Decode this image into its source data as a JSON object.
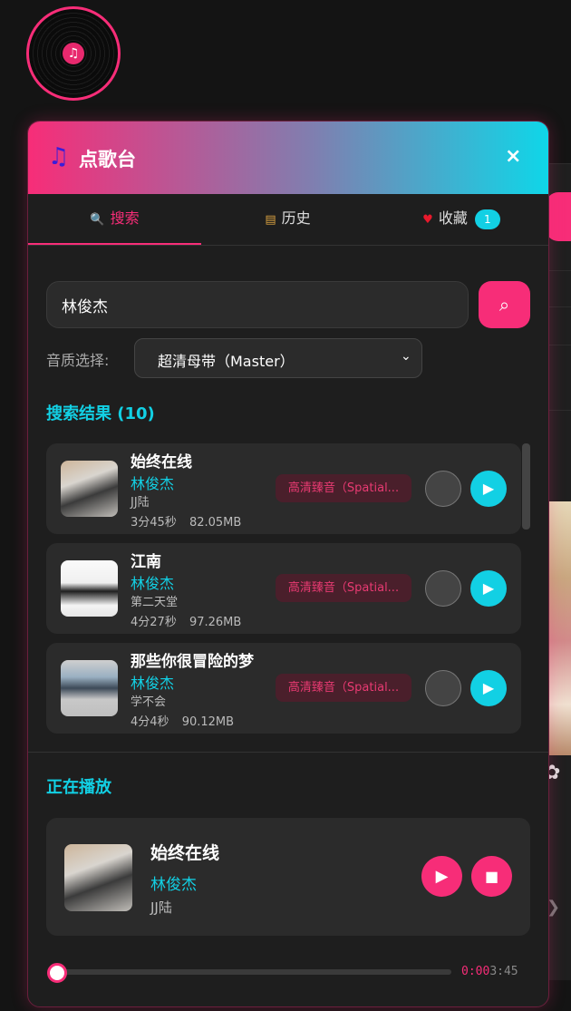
{
  "header": {
    "icon": "music-note-icon",
    "title": "点歌台",
    "close_label": "×"
  },
  "tabs": [
    {
      "icon": "magnifier-icon",
      "label": "搜索",
      "active": true
    },
    {
      "icon": "books-icon",
      "label": "历史",
      "active": false
    },
    {
      "icon": "heart-icon",
      "label": "收藏",
      "badge": "1",
      "active": false
    }
  ],
  "search": {
    "value": "林俊杰",
    "button_icon": "search-icon"
  },
  "quality": {
    "label": "音质选择:",
    "selected": "超清母带（Master）"
  },
  "results": {
    "title": "搜索结果 (10)",
    "items": [
      {
        "title": "始终在线",
        "artist": "林俊杰",
        "album": "JJ陆",
        "duration": "3分45秒",
        "size": "82.05MB",
        "quality_tag": "高清臻音（Spatial..."
      },
      {
        "title": "江南",
        "artist": "林俊杰",
        "album": "第二天堂",
        "duration": "4分27秒",
        "size": "97.26MB",
        "quality_tag": "高清臻音（Spatial..."
      },
      {
        "title": "那些你很冒险的梦",
        "artist": "林俊杰",
        "album": "学不会",
        "duration": "4分4秒",
        "size": "90.12MB",
        "quality_tag": "高清臻音（Spatial..."
      }
    ]
  },
  "now_playing": {
    "title": "正在播放",
    "song": "始终在线",
    "artist": "林俊杰",
    "album": "JJ陆",
    "current_time": "0:00",
    "total_time": "3:45",
    "progress": 0.0
  },
  "colors": {
    "accent_pink": "#f72d78",
    "accent_cyan": "#12d0e4",
    "panel_bg": "#1e1e1e"
  }
}
